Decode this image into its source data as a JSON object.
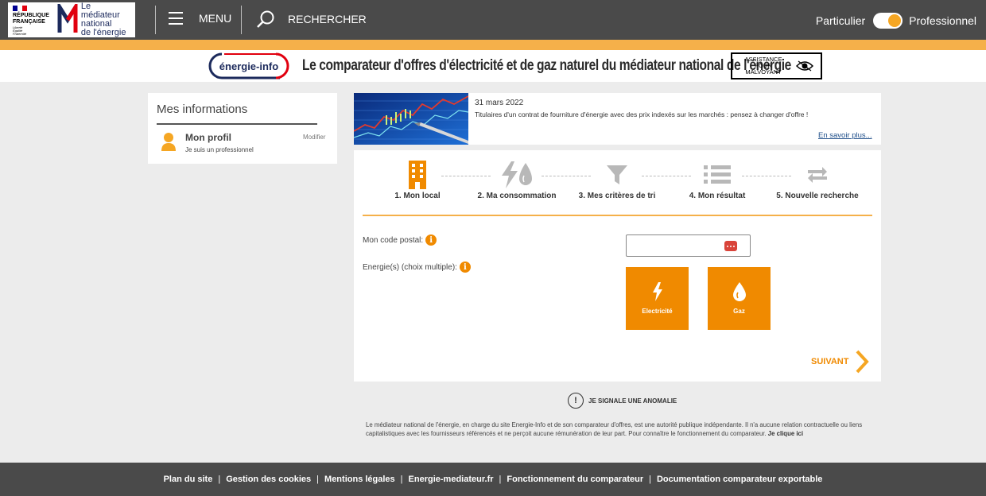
{
  "header": {
    "republic": [
      "RÉPUBLIQUE",
      "FRANÇAISE"
    ],
    "republic_motto": [
      "Liberté",
      "Égalité",
      "Fraternité"
    ],
    "mne_title": [
      "Le médiateur",
      "national",
      "de l'énergie"
    ],
    "menu_label": "MENU",
    "search_label": "RECHERCHER",
    "profile_left": "Particulier",
    "profile_right": "Professionnel",
    "profile_selected": "Professionnel"
  },
  "banner": {
    "logo_text": "énergie-info",
    "title": "Le comparateur d'offres d'électricité et de gaz naturel du médiateur national de l'énergie",
    "assist_label": [
      "ASSISTANCE",
      "POUR",
      "MALVOYANT"
    ]
  },
  "sidebar": {
    "title": "Mes informations",
    "profile_name": "Mon profil",
    "profile_sub": "Je suis un professionnel",
    "modify_label": "Modifier"
  },
  "news": {
    "date": "31 mars 2022",
    "text": "Titulaires d'un contrat de fourniture d'énergie avec des prix indexés sur les marchés : pensez à changer d'offre !",
    "more_label": "En savoir plus..."
  },
  "steps": [
    {
      "label": "1. Mon local",
      "icon": "building-icon",
      "active": true
    },
    {
      "label": "2. Ma consommation",
      "icon": "energy-consumption-icon",
      "active": false
    },
    {
      "label": "3. Mes critères de tri",
      "icon": "filter-icon",
      "active": false
    },
    {
      "label": "4. Mon résultat",
      "icon": "list-icon",
      "active": false
    },
    {
      "label": "5. Nouvelle recherche",
      "icon": "refresh-icon",
      "active": false
    }
  ],
  "form": {
    "postal_label": "Mon code postal:",
    "postal_value": "",
    "postal_placeholder": "",
    "energy_label": "Energie(s) (choix multiple):",
    "energy_options": [
      {
        "label": "Electricité",
        "icon": "lightning-icon"
      },
      {
        "label": "Gaz",
        "icon": "flame-icon"
      }
    ],
    "next_label": "SUIVANT"
  },
  "anomaly_label": "JE SIGNALE UNE ANOMALIE",
  "disclaimer": {
    "text": "Le médiateur national de l'énergie, en charge du site Energie-Info et de son comparateur d'offres, est une autorité publique indépendante. Il n'a aucune relation contractuelle ou liens capitalistiques avec les fournisseurs référencés et ne perçoit aucune rémunération de leur part. Pour connaître le fonctionnement du comparateur.",
    "link": "Je clique ici"
  },
  "footer": {
    "links": [
      "Plan du site",
      "Gestion des cookies",
      "Mentions légales",
      "Energie-mediateur.fr",
      "Fonctionnement du comparateur",
      "Documentation comparateur exportable"
    ]
  },
  "colors": {
    "header_bg": "#4a4a4a",
    "accent_orange": "#f08a00",
    "strip_orange": "#f5b04a",
    "inactive_gray": "#b8b8b8"
  }
}
